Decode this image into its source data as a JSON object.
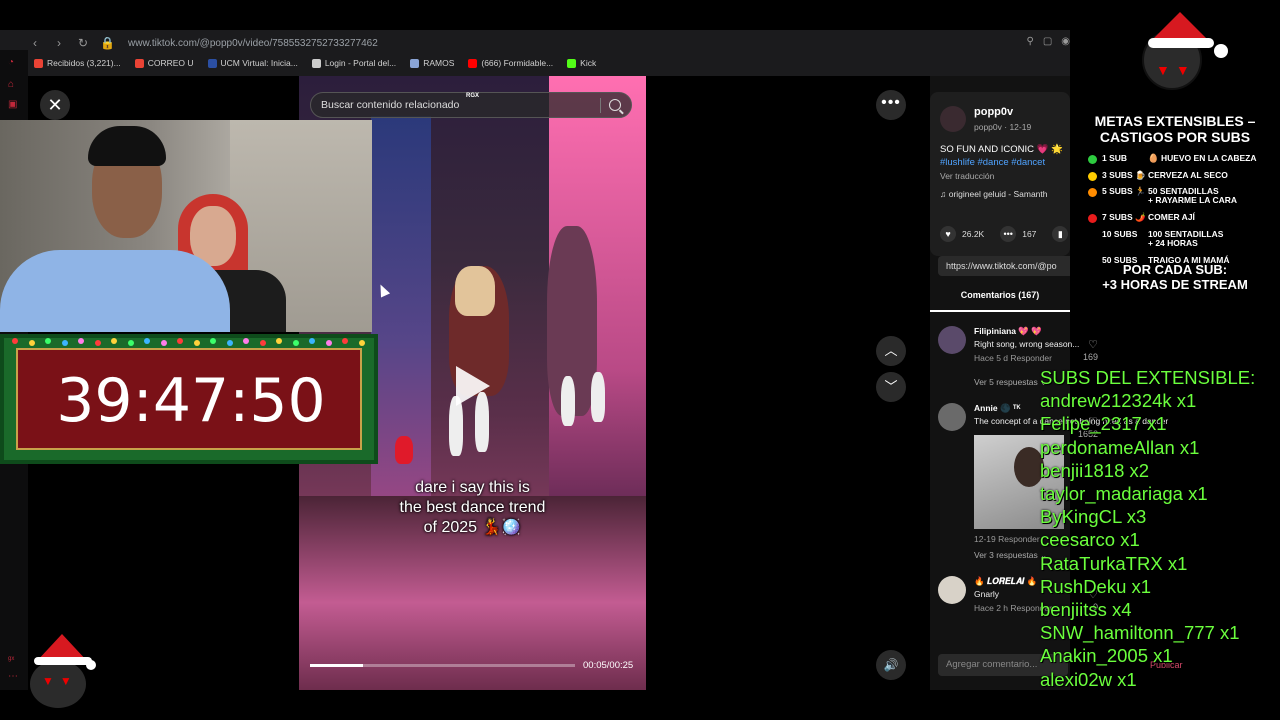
{
  "browser": {
    "url": "www.tiktok.com/@popp0v/video/7585532752733277462",
    "bookmarks": [
      {
        "label": "Recibidos (3,221)...",
        "color": "#ea4335"
      },
      {
        "label": "CORREO U",
        "color": "#ea4335"
      },
      {
        "label": "UCM Virtual: Inicia...",
        "color": "#2b4fa3"
      },
      {
        "label": "Login - Portal del...",
        "color": "#cccccc"
      },
      {
        "label": "RAMOS",
        "color": "#8aa4d6"
      },
      {
        "label": "(666) Formidable...",
        "color": "#ff0000"
      },
      {
        "label": "Kick",
        "color": "#53fc18"
      }
    ]
  },
  "video": {
    "search_placeholder": "Buscar contenido relacionado",
    "search_tag": "RGX",
    "caption_line1": "dare i say this is",
    "caption_line2": "the best dance trend",
    "caption_line3": "of 2025 💃🪩",
    "time": "00:05/00:25",
    "progress": 0.2
  },
  "post": {
    "username": "popp0v",
    "meta": "popp0v · 12-19",
    "description": "SO FUN AND ICONIC 💗 🌟",
    "hashtags": "#lushlife #dance #dancet",
    "translate": "Ver traducción",
    "sound": "♫ origineel geluid - Samanth",
    "likes": "26.2K",
    "comments_count": "167",
    "link": "https://www.tiktok.com/@po",
    "comments_tab": "Comentarios (167)",
    "comment_placeholder": "Agregar comentario...",
    "publish": "Publicar"
  },
  "comments": [
    {
      "user": "Filipiniana 💖 💖",
      "text": "Right song, wrong season...",
      "meta": "Hace 5 d   Responder",
      "replies": "Ver 5 respuestas ⌄",
      "likes": "169"
    },
    {
      "user": "Annie 🌑 ᵀᴷ",
      "text": "The concept of a dance not being hired as a dancer",
      "meta": "12-19   Responder",
      "replies": "Ver 3 respuestas ⌄",
      "likes": "1652"
    },
    {
      "user": "🔥 𝑳𝑶𝑹𝑬𝑳𝑨𝑰 🔥",
      "text": "Gnarly",
      "meta": "Hace 2 h   Responder",
      "replies": "",
      "likes": "0"
    }
  ],
  "timer": "39:47:50",
  "metas": {
    "title_line1": "METAS EXTENSIBLES –",
    "title_line2": "CASTIGOS POR SUBS",
    "items": [
      {
        "subs": "1 SUB",
        "reward": "🥚 HUEVO EN LA CABEZA",
        "color": "#2ecc40"
      },
      {
        "subs": "3 SUBS 🍺",
        "reward": "CERVEZA AL SECO",
        "color": "#ffcc00"
      },
      {
        "subs": "5 SUBS 🏃",
        "reward": "50 SENTADILLAS\n+ RAYARME LA CARA",
        "color": "#ff8c00"
      },
      {
        "subs": "7 SUBS 🌶️",
        "reward": "COMER AJÍ",
        "color": "#e81c1c"
      },
      {
        "subs": "10 SUBS",
        "reward": "100 SENTADILLAS\n+ 24 HORAS",
        "color": ""
      },
      {
        "subs": "50 SUBS",
        "reward": "TRAIGO A MI MAMÁ",
        "color": ""
      }
    ],
    "footer_line1": "POR CADA SUB:",
    "footer_line2": "+3 HORAS DE STREAM"
  },
  "subs_list": {
    "title": "SUBS DEL EXTENSIBLE:",
    "entries": [
      "andrew212324k x1",
      "Felipe_2317 x1",
      "perdonameAllan x1",
      "benjii1818 x2",
      "taylor_madariaga x1",
      "ByKingCL x3",
      "ceesarco x1",
      "RataTurkaTRX x1",
      "RushDeku x1",
      "benjiitss x4",
      "SNW_hamiltonn_777 x1",
      "Anakin_2005 x1",
      "alexi02w x1"
    ]
  }
}
